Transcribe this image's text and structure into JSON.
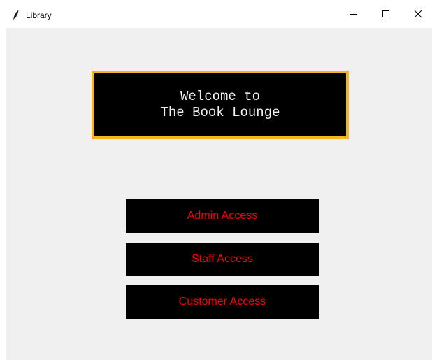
{
  "window": {
    "title": "Library",
    "controls": {
      "minimize_icon": "minimize-icon",
      "maximize_icon": "maximize-icon",
      "close_icon": "close-icon"
    }
  },
  "banner": {
    "line1": "Welcome to",
    "line2": "The Book Lounge"
  },
  "buttons": {
    "admin": "Admin Access",
    "staff": "Staff Access",
    "customer": "Customer Access"
  },
  "colors": {
    "background": "#f0f0f0",
    "banner_bg": "#000000",
    "banner_border": "#f5b51c",
    "banner_text": "#f2f2f2",
    "button_bg": "#000000",
    "button_text": "#ff0000"
  }
}
